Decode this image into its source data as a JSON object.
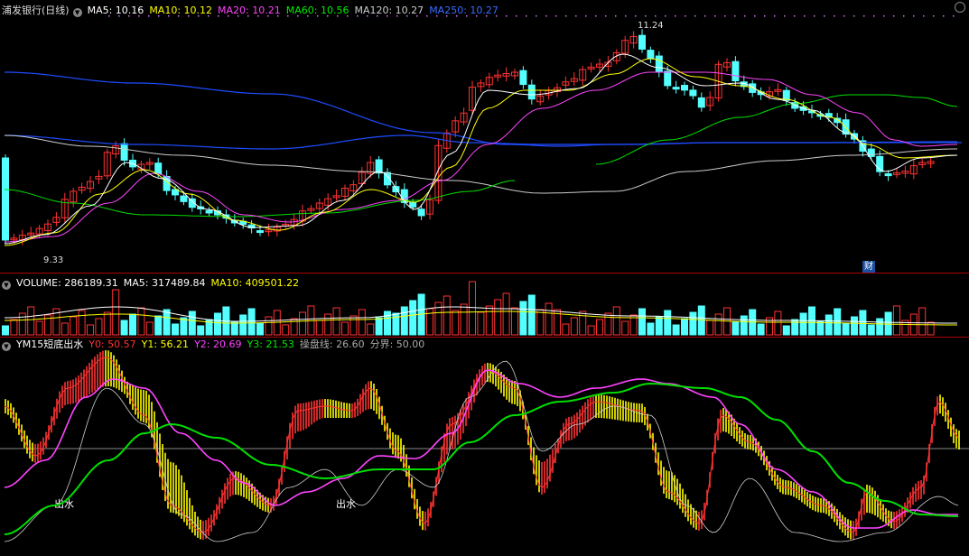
{
  "price_legend": {
    "title": "浦发银行(日线)",
    "ma5": "MA5: 10.16",
    "ma10": "MA10: 10.12",
    "ma20": "MA20: 10.21",
    "ma60": "MA60: 10.56",
    "ma120": "MA120: 10.27",
    "ma250": "MA250: 10.27"
  },
  "volume_legend": {
    "vol": "VOLUME: 286189.31",
    "ma5": "MA5: 317489.84",
    "ma10": "MA10: 409501.22"
  },
  "ind_legend": {
    "name": "YM15短底出水",
    "y0": "Y0: 50.57",
    "y1": "Y1: 56.21",
    "y2": "Y2: 20.69",
    "y3": "Y3: 21.53",
    "line": "操盘线: 26.60",
    "bound": "分界: 50.00"
  },
  "annotations": {
    "high": "11.24",
    "low": "9.33",
    "cai": "财",
    "chushui1": "出水",
    "chushui2": "出水"
  },
  "colors": {
    "up": "#ff3232",
    "down": "#54ffff",
    "ma5": "#ffffff",
    "ma10": "#ffff00",
    "ma20": "#ff44ff",
    "ma60": "#00e000",
    "ma120": "#cccccc",
    "ma250": "#1e4cff",
    "grid": "#a00000"
  },
  "chart_data": [
    {
      "type": "candlestick",
      "title": "浦发银行(日线)",
      "annotated_high": 11.24,
      "annotated_low": 9.33,
      "series": [
        {
          "name": "MA5",
          "last": 10.16
        },
        {
          "name": "MA10",
          "last": 10.12
        },
        {
          "name": "MA20",
          "last": 10.21
        },
        {
          "name": "MA60",
          "last": 10.56
        },
        {
          "name": "MA120",
          "last": 10.27
        },
        {
          "name": "MA250",
          "last": 10.27
        }
      ],
      "ylim": [
        9.25,
        11.35
      ]
    },
    {
      "type": "bar",
      "title": "VOLUME",
      "series": [
        {
          "name": "VOLUME",
          "last": 286189.31
        },
        {
          "name": "MA5",
          "last": 317489.84
        },
        {
          "name": "MA10",
          "last": 409501.22
        }
      ]
    },
    {
      "type": "line",
      "title": "YM15短底出水",
      "series": [
        {
          "name": "Y0",
          "last": 50.57
        },
        {
          "name": "Y1",
          "last": 56.21
        },
        {
          "name": "Y2",
          "last": 20.69
        },
        {
          "name": "Y3",
          "last": 21.53
        },
        {
          "name": "操盘线",
          "last": 26.6
        },
        {
          "name": "分界",
          "last": 50.0
        }
      ]
    }
  ]
}
